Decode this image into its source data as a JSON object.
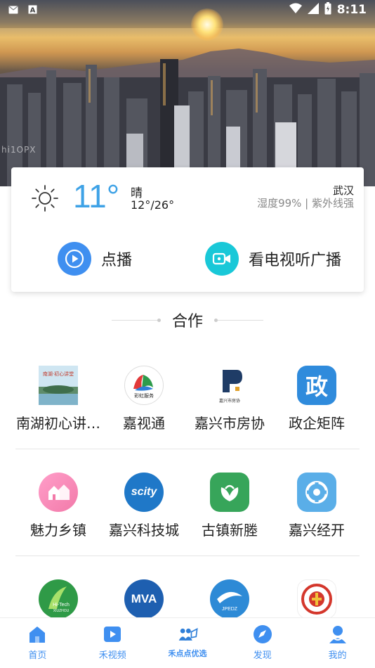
{
  "status_bar": {
    "time": "8:11",
    "left_icons": [
      "mail-icon",
      "font-a-icon"
    ],
    "right_icons": [
      "wifi-icon",
      "signal-icon",
      "battery-icon"
    ]
  },
  "hero": {
    "watermark": "hi1OPX"
  },
  "weather": {
    "temperature": "11°",
    "condition": "晴",
    "range": "12°/26°",
    "city": "武汉",
    "humidity": "湿度99% | 紫外线强",
    "accent": "#3ea2e6"
  },
  "actions": {
    "play_label": "点播",
    "tv_label": "看电视听广播"
  },
  "section": {
    "title": "合作"
  },
  "rows": [
    {
      "items": [
        {
          "label": "南湖初心讲…",
          "icon": "nanhu-lake-icon"
        },
        {
          "label": "嘉视通",
          "icon": "rainbow-service-icon"
        },
        {
          "label": "嘉兴市房协",
          "icon": "housing-association-icon"
        },
        {
          "label": "政企矩阵",
          "icon": "government-icon"
        }
      ]
    },
    {
      "items": [
        {
          "label": "魅力乡镇",
          "icon": "town-icon"
        },
        {
          "label": "嘉兴科技城",
          "icon": "scity-icon"
        },
        {
          "label": "古镇新塍",
          "icon": "ancient-town-icon"
        },
        {
          "label": "嘉兴经开",
          "icon": "development-zone-icon"
        }
      ]
    },
    {
      "items": [
        {
          "label": "",
          "icon": "hitech-icon"
        },
        {
          "label": "",
          "icon": "mva-icon"
        },
        {
          "label": "",
          "icon": "jpedz-icon"
        },
        {
          "label": "",
          "icon": "union-emblem-icon"
        }
      ]
    }
  ],
  "cell_text": {
    "housing_small": "嘉兴市房协",
    "scity": "scity",
    "mva": "MVA",
    "jpedz": "JPEDZ",
    "hitech": "Hi-Tech",
    "hitech_sub": "XIUZHOU",
    "gov": "政",
    "rainbow": "彩虹服务",
    "nanhu": "南湖·初心讲堂"
  },
  "bottom_nav": [
    {
      "label": "首页",
      "icon": "home-icon"
    },
    {
      "label": "禾视频",
      "icon": "video-icon"
    },
    {
      "label": "禾点点优选",
      "icon": "shopping-icon"
    },
    {
      "label": "发现",
      "icon": "compass-icon"
    },
    {
      "label": "我的",
      "icon": "profile-icon"
    }
  ]
}
